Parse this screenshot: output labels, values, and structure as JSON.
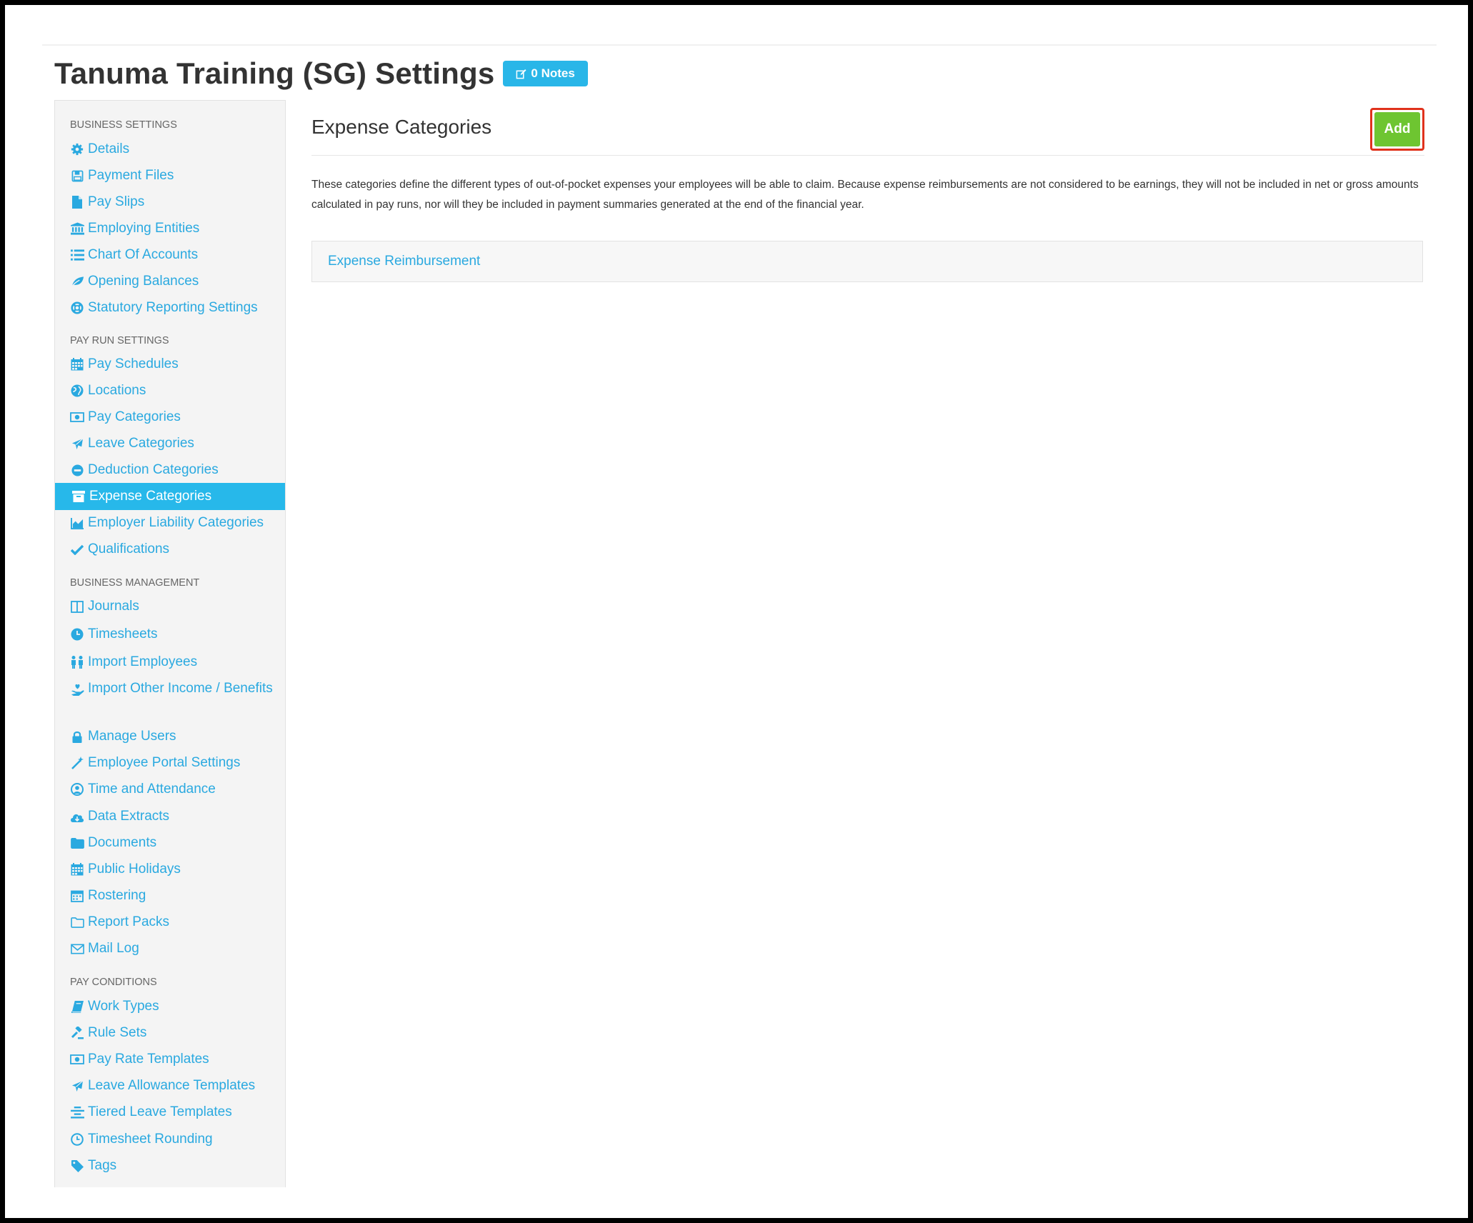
{
  "page": {
    "title": "Tanuma Training (SG) Settings",
    "notes_badge": "0 Notes"
  },
  "colors": {
    "accent": "#29b6e8",
    "link": "#2aa9e0",
    "add_button": "#6ec531",
    "highlight_border": "#e0321c"
  },
  "sidebar": {
    "business_settings": {
      "title": "BUSINESS SETTINGS",
      "items": [
        {
          "label": "Details",
          "icon": "gear-icon"
        },
        {
          "label": "Payment Files",
          "icon": "floppy-icon"
        },
        {
          "label": "Pay Slips",
          "icon": "file-icon"
        },
        {
          "label": "Employing Entities",
          "icon": "bank-icon"
        },
        {
          "label": "Chart Of Accounts",
          "icon": "list-icon"
        },
        {
          "label": "Opening Balances",
          "icon": "leaf-icon"
        },
        {
          "label": "Statutory Reporting Settings",
          "icon": "lifebuoy-icon"
        }
      ]
    },
    "pay_run_settings": {
      "title": "PAY RUN SETTINGS",
      "items": [
        {
          "label": "Pay Schedules",
          "icon": "calendar-icon"
        },
        {
          "label": "Locations",
          "icon": "globe-icon"
        },
        {
          "label": "Pay Categories",
          "icon": "money-icon"
        },
        {
          "label": "Leave Categories",
          "icon": "plane-icon"
        },
        {
          "label": "Deduction Categories",
          "icon": "minus-circle-icon"
        },
        {
          "label": "Expense Categories",
          "icon": "archive-icon",
          "active": true
        },
        {
          "label": "Employer Liability Categories",
          "icon": "area-chart-icon"
        },
        {
          "label": "Qualifications",
          "icon": "check-icon"
        }
      ]
    },
    "business_management": {
      "title": "BUSINESS MANAGEMENT",
      "items": [
        {
          "label": "Journals",
          "icon": "columns-icon"
        },
        {
          "label": "Timesheets",
          "icon": "clock-icon"
        },
        {
          "label": "Import Employees",
          "icon": "users-icon"
        },
        {
          "label": "Import Other Income / Benefits",
          "icon": "hand-heart-icon"
        },
        {
          "label": "Manage Users",
          "icon": "lock-icon"
        },
        {
          "label": "Employee Portal Settings",
          "icon": "wand-icon"
        },
        {
          "label": "Time and Attendance",
          "icon": "user-clock-icon"
        },
        {
          "label": "Data Extracts",
          "icon": "cloud-download-icon"
        },
        {
          "label": "Documents",
          "icon": "folder-icon"
        },
        {
          "label": "Public Holidays",
          "icon": "calendar-icon"
        },
        {
          "label": "Rostering",
          "icon": "calendar-grid-icon"
        },
        {
          "label": "Report Packs",
          "icon": "folder-open-icon"
        },
        {
          "label": "Mail Log",
          "icon": "envelope-icon"
        }
      ]
    },
    "pay_conditions": {
      "title": "PAY CONDITIONS",
      "items": [
        {
          "label": "Work Types",
          "icon": "book-icon"
        },
        {
          "label": "Rule Sets",
          "icon": "gavel-icon"
        },
        {
          "label": "Pay Rate Templates",
          "icon": "money-icon"
        },
        {
          "label": "Leave Allowance Templates",
          "icon": "plane-icon"
        },
        {
          "label": "Tiered Leave Templates",
          "icon": "align-center-icon"
        },
        {
          "label": "Timesheet Rounding",
          "icon": "clock-outline-icon"
        },
        {
          "label": "Tags",
          "icon": "tag-icon"
        }
      ]
    }
  },
  "main": {
    "title": "Expense Categories",
    "add_label": "Add",
    "description": "These categories define the different types of out-of-pocket expenses your employees will be able to claim. Because expense reimbursements are not considered to be earnings, they will not be included in net or gross amounts calculated in pay runs, nor will they be included in payment summaries generated at the end of the financial year.",
    "categories": [
      {
        "label": "Expense Reimbursement"
      }
    ]
  }
}
